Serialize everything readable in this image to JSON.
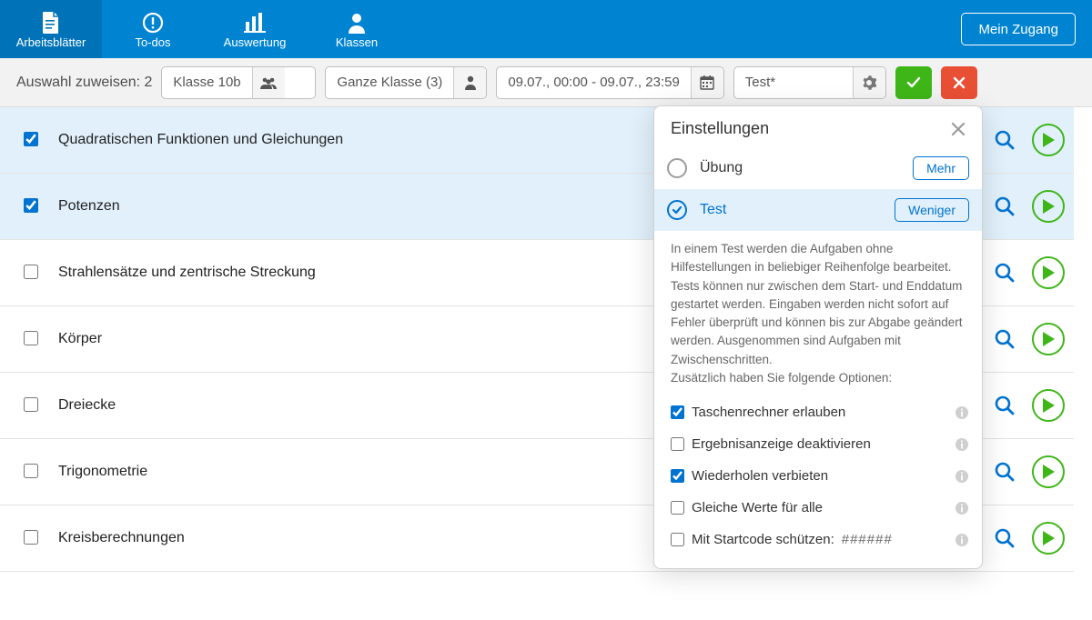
{
  "nav": {
    "tabs": [
      {
        "label": "Arbeitsblätter",
        "active": true,
        "icon": "document"
      },
      {
        "label": "To-dos",
        "active": false,
        "icon": "alert"
      },
      {
        "label": "Auswertung",
        "active": false,
        "icon": "bars"
      },
      {
        "label": "Klassen",
        "active": false,
        "icon": "user"
      }
    ],
    "account_label": "Mein Zugang"
  },
  "toolbar": {
    "assign_label": "Auswahl zuweisen: 2",
    "class_value": "Klasse 10b",
    "group_value": "Ganze Klasse (3)",
    "date_value": "09.07., 00:00 - 09.07., 23:59",
    "mode_value": "Test*"
  },
  "worksheets": [
    {
      "title": "Quadratischen Funktionen und Gleichungen",
      "checked": true
    },
    {
      "title": "Potenzen",
      "checked": true
    },
    {
      "title": "Strahlensätze und zentrische Streckung",
      "checked": false
    },
    {
      "title": "Körper",
      "checked": false
    },
    {
      "title": "Dreiecke",
      "checked": false
    },
    {
      "title": "Trigonometrie",
      "checked": false
    },
    {
      "title": "Kreisberechnungen",
      "checked": false
    }
  ],
  "settings": {
    "title": "Einstellungen",
    "mode_exercise": "Übung",
    "btn_more": "Mehr",
    "mode_test": "Test",
    "btn_less": "Weniger",
    "description": "In einem Test werden die Aufgaben ohne Hilfestellungen in beliebiger Reihenfolge bearbeitet. Tests können nur zwischen dem Start- und Enddatum gestartet werden. Eingaben werden nicht sofort auf Fehler überprüft und können bis zur Abgabe geändert werden. Ausgenommen sind Aufgaben mit Zwischenschritten.",
    "description_extra": "Zusätzlich haben Sie folgende Optionen:",
    "options": [
      {
        "label": "Taschenrechner erlauben",
        "checked": true
      },
      {
        "label": "Ergebnisanzeige deaktivieren",
        "checked": false
      },
      {
        "label": "Wiederholen verbieten",
        "checked": true
      },
      {
        "label": "Gleiche Werte für alle",
        "checked": false
      }
    ],
    "startcode_label": "Mit Startcode schützen:",
    "startcode_value": "######"
  }
}
